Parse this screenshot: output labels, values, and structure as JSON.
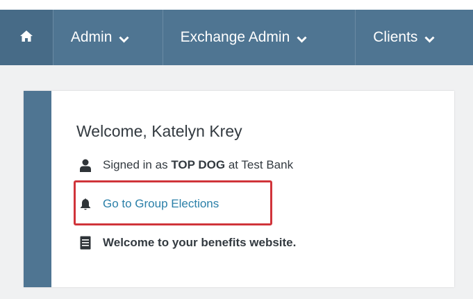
{
  "nav": {
    "home_icon": "home-icon",
    "items": [
      {
        "label": "Admin"
      },
      {
        "label": "Exchange Admin"
      },
      {
        "label": "Clients"
      }
    ]
  },
  "card": {
    "welcome": "Welcome, Katelyn Krey",
    "signed_prefix": "Signed in as",
    "signed_role": "TOP DOG",
    "signed_suffix": "at Test Bank",
    "elections_link": "Go to Group Elections",
    "benefits_text": "Welcome to your benefits website."
  },
  "colors": {
    "nav_bg": "#4f7592",
    "link": "#2a7fa8",
    "highlight": "#d0343a"
  }
}
